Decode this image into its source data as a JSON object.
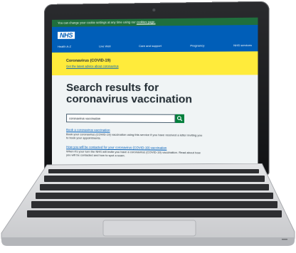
{
  "cookie_bar": {
    "text": "You can change your cookie settings at any time using our ",
    "link": "cookies page."
  },
  "header": {
    "logo": "NHS",
    "nav": [
      "Health A-Z",
      "Live Well",
      "Care and support",
      "Pregnancy",
      "NHS services"
    ]
  },
  "alert": {
    "title": "Coronavirus (COVID-19)",
    "link": "Get the latest advice about coronavirus"
  },
  "main": {
    "heading": "Search results for coronavirus vaccination",
    "search_value": "coronavirus vaccination",
    "results": [
      {
        "title": "Book a coronavirus vaccination",
        "text": "Book your coronavirus (COVID-19) vaccination using this service if you have received a letter inviting you to book your appointments."
      },
      {
        "title": "How you will be contacted for your coronavirus (COVID-19) vaccination",
        "text": "When it's your turn the NHS will invite you have a coronavirus (COVID-19) vaccination. Read about how you will be contacted and how to spot a scam."
      }
    ]
  },
  "colors": {
    "nhs_blue": "#005eb8",
    "cookie_green": "#1f6f3d",
    "alert_yellow": "#ffeb3b",
    "search_green": "#007f3b"
  }
}
